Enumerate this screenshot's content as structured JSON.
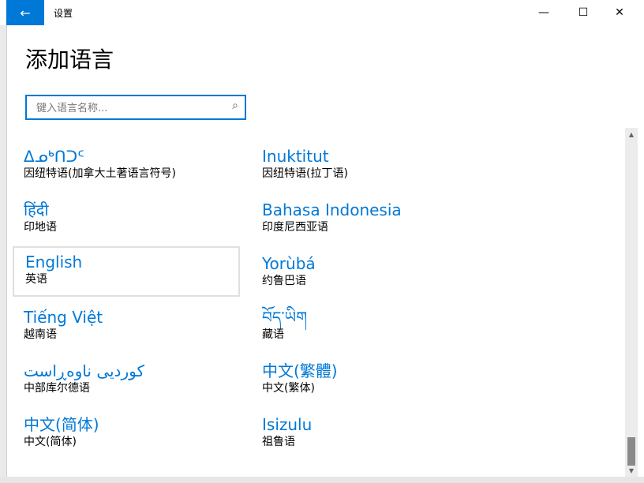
{
  "window": {
    "title": "设置",
    "back_icon": "←",
    "minimize_icon": "—",
    "maximize_icon": "☐",
    "close_icon": "✕"
  },
  "page_title": "添加语言",
  "search": {
    "placeholder": "键入语言名称...",
    "icon": "⌕"
  },
  "languages": [
    {
      "name": "ᐃᓄᒃᑎᑐᑦ",
      "subtitle": "因纽特语(加拿大土著语言符号)"
    },
    {
      "name": "Inuktitut",
      "subtitle": "因纽特语(拉丁语)"
    },
    {
      "name": "हिंदी",
      "subtitle": "印地语"
    },
    {
      "name": "Bahasa Indonesia",
      "subtitle": "印度尼西亚语"
    },
    {
      "name": "English",
      "subtitle": "英语"
    },
    {
      "name": "Yorùbá",
      "subtitle": "约鲁巴语"
    },
    {
      "name": "Tiếng Việt",
      "subtitle": "越南语"
    },
    {
      "name": "བོད་ཡིག",
      "subtitle": "藏语"
    },
    {
      "name": "کوردیی ناوەڕاست",
      "subtitle": "中部库尔德语"
    },
    {
      "name": "中文(繁體)",
      "subtitle": "中文(繁体)"
    },
    {
      "name": "中文(简体)",
      "subtitle": "中文(简体)"
    },
    {
      "name": "Isizulu",
      "subtitle": "祖鲁语"
    }
  ],
  "selected_language": "English",
  "scroll": {
    "up_icon": "▲",
    "down_icon": "▼"
  },
  "colors": {
    "accent": "#0078d7",
    "background": "#ffffff"
  }
}
